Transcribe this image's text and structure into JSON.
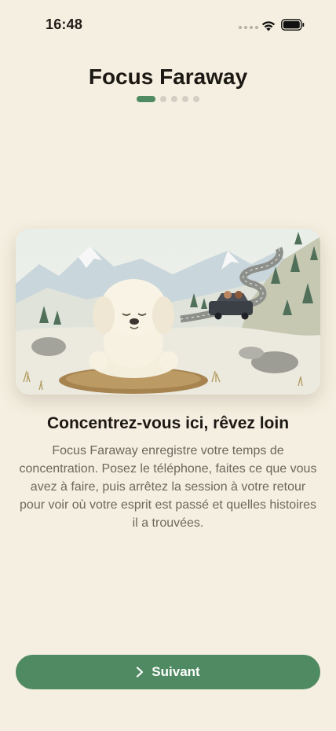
{
  "status_bar": {
    "time": "16:48"
  },
  "header": {
    "title": "Focus Faraway",
    "pager": {
      "total": 5,
      "current": 1
    }
  },
  "hero": {
    "image": "meditating-poodle-mountain-road-illustration"
  },
  "content": {
    "headline": "Concentrez-vous ici, rêvez loin",
    "body": "Focus Faraway enregistre votre temps de concentration. Posez le téléphone, faites ce que vous avez à faire, puis arrêtez la session à votre retour pour voir où votre esprit est passé et quelles histoires il a trouvées."
  },
  "footer": {
    "next_label": "Suivant",
    "next_icon": "chevron-right-icon"
  },
  "colors": {
    "background": "#f5efe1",
    "accent": "#4f8a62",
    "dot_inactive": "#d4cfc4"
  }
}
